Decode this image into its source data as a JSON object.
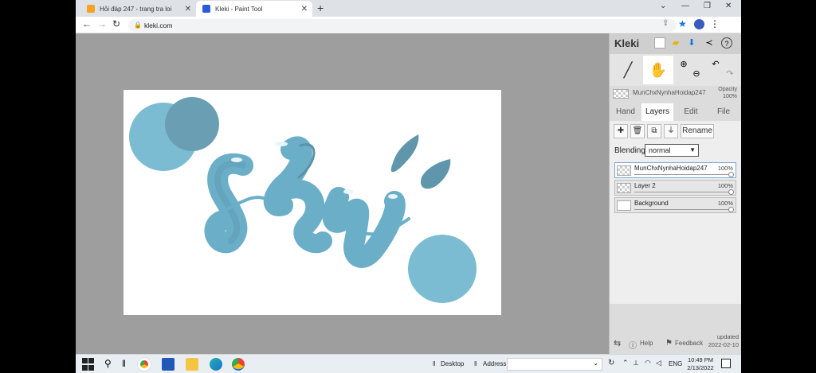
{
  "browser": {
    "tabs": [
      {
        "title": "Hỏi đáp 247 - trang tra loi",
        "favicon_color": "#f4a322"
      },
      {
        "title": "Kleki - Paint Tool",
        "favicon_color": "#2b5bd7"
      }
    ],
    "url": "kleki.com"
  },
  "app": {
    "logo": "Kleki",
    "active_layer_name": "MunChxNynhaHoidap247",
    "opacity_label": "Opacity",
    "opacity_value": "100%",
    "panel_tabs": [
      "Hand",
      "Layers",
      "Edit",
      "File"
    ],
    "active_panel_tab": "Layers",
    "buttons": {
      "rename": "Rename"
    },
    "blending_label": "Blending",
    "blending_value": "normal",
    "layers": [
      {
        "name": "MunChxNynhaHoidap247",
        "opacity": "100%",
        "active": true
      },
      {
        "name": "Layer 2",
        "opacity": "100%",
        "active": false
      },
      {
        "name": "Background",
        "opacity": "100%",
        "active": false
      }
    ],
    "footer": {
      "help": "Help",
      "feedback": "Feedback",
      "updated_label": "updated",
      "updated_date": "2022-02-10"
    }
  },
  "canvas_art": {
    "word": "sky",
    "color": "#6aaec8",
    "color_dark": "#5b93a8"
  },
  "taskbar": {
    "desktop": "Desktop",
    "address": "Address",
    "language": "ENG",
    "time": "10:49 PM",
    "date": "2/13/2022"
  }
}
